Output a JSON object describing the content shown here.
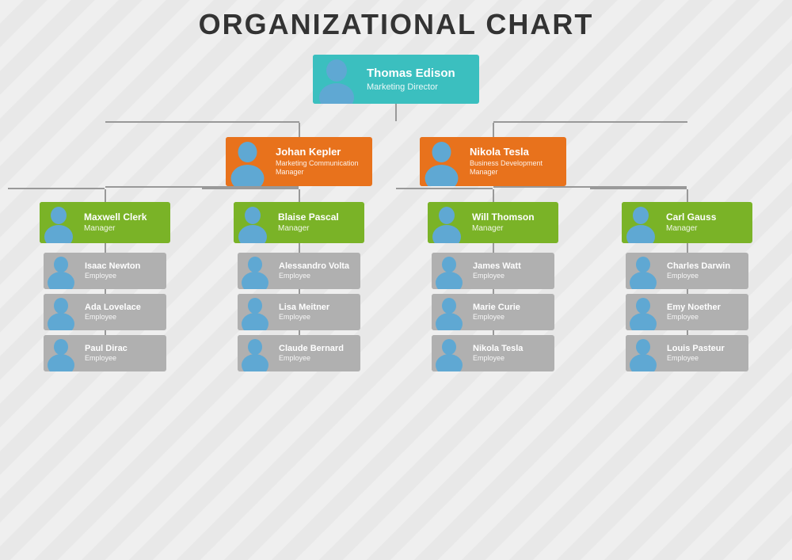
{
  "title": "ORGANIZATIONAL CHART",
  "nodes": {
    "top": {
      "name": "Thomas Edison",
      "role": "Marketing Director",
      "color": "teal",
      "genderFemale": false
    },
    "l2": [
      {
        "name": "Johan Kepler",
        "role": "Marketing Communication Manager",
        "color": "orange",
        "genderFemale": true,
        "children": [
          {
            "name": "Maxwell Clerk",
            "role": "Manager",
            "color": "green",
            "genderFemale": false,
            "employees": [
              {
                "name": "Isaac Newton",
                "role": "Employee",
                "genderFemale": false
              },
              {
                "name": "Ada Lovelace",
                "role": "Employee",
                "genderFemale": true
              },
              {
                "name": "Paul Dirac",
                "role": "Employee",
                "genderFemale": false
              }
            ]
          },
          {
            "name": "Blaise Pascal",
            "role": "Manager",
            "color": "green",
            "genderFemale": false,
            "employees": [
              {
                "name": "Alessandro Volta",
                "role": "Employee",
                "genderFemale": false
              },
              {
                "name": "Lisa Meitner",
                "role": "Employee",
                "genderFemale": true
              },
              {
                "name": "Claude Bernard",
                "role": "Employee",
                "genderFemale": false
              }
            ]
          }
        ]
      },
      {
        "name": "Nikola Tesla",
        "role": "Business Development Manager",
        "color": "orange",
        "genderFemale": false,
        "children": [
          {
            "name": "Will Thomson",
            "role": "Manager",
            "color": "green",
            "genderFemale": false,
            "employees": [
              {
                "name": "James Watt",
                "role": "Employee",
                "genderFemale": false
              },
              {
                "name": "Marie Curie",
                "role": "Employee",
                "genderFemale": true
              },
              {
                "name": "Nikola Tesla",
                "role": "Employee",
                "genderFemale": false
              }
            ]
          },
          {
            "name": "Carl Gauss",
            "role": "Manager",
            "color": "green",
            "genderFemale": false,
            "employees": [
              {
                "name": "Charles Darwin",
                "role": "Employee",
                "genderFemale": false
              },
              {
                "name": "Emy Noether",
                "role": "Employee",
                "genderFemale": true
              },
              {
                "name": "Louis Pasteur",
                "role": "Employee",
                "genderFemale": false
              }
            ]
          }
        ]
      }
    ]
  },
  "colors": {
    "teal": "#3bbfbf",
    "orange": "#e8721c",
    "green": "#7ab327",
    "gray": "#b0b0b0",
    "line": "#999999"
  }
}
